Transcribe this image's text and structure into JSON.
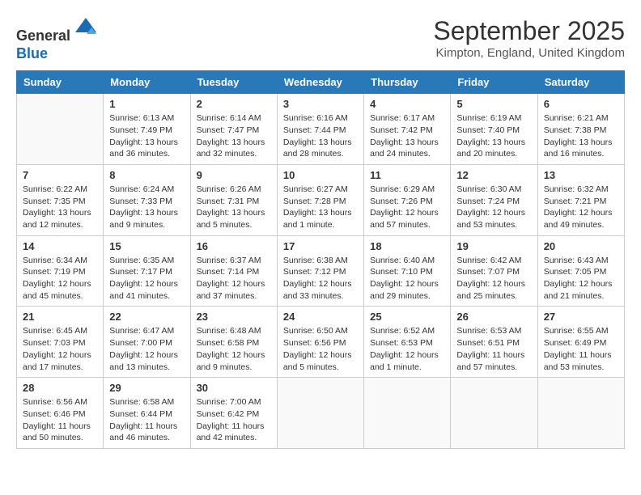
{
  "header": {
    "logo_line1": "General",
    "logo_line2": "Blue",
    "month_title": "September 2025",
    "location": "Kimpton, England, United Kingdom"
  },
  "days_of_week": [
    "Sunday",
    "Monday",
    "Tuesday",
    "Wednesday",
    "Thursday",
    "Friday",
    "Saturday"
  ],
  "weeks": [
    [
      {
        "day": "",
        "info": ""
      },
      {
        "day": "1",
        "info": "Sunrise: 6:13 AM\nSunset: 7:49 PM\nDaylight: 13 hours\nand 36 minutes."
      },
      {
        "day": "2",
        "info": "Sunrise: 6:14 AM\nSunset: 7:47 PM\nDaylight: 13 hours\nand 32 minutes."
      },
      {
        "day": "3",
        "info": "Sunrise: 6:16 AM\nSunset: 7:44 PM\nDaylight: 13 hours\nand 28 minutes."
      },
      {
        "day": "4",
        "info": "Sunrise: 6:17 AM\nSunset: 7:42 PM\nDaylight: 13 hours\nand 24 minutes."
      },
      {
        "day": "5",
        "info": "Sunrise: 6:19 AM\nSunset: 7:40 PM\nDaylight: 13 hours\nand 20 minutes."
      },
      {
        "day": "6",
        "info": "Sunrise: 6:21 AM\nSunset: 7:38 PM\nDaylight: 13 hours\nand 16 minutes."
      }
    ],
    [
      {
        "day": "7",
        "info": "Sunrise: 6:22 AM\nSunset: 7:35 PM\nDaylight: 13 hours\nand 12 minutes."
      },
      {
        "day": "8",
        "info": "Sunrise: 6:24 AM\nSunset: 7:33 PM\nDaylight: 13 hours\nand 9 minutes."
      },
      {
        "day": "9",
        "info": "Sunrise: 6:26 AM\nSunset: 7:31 PM\nDaylight: 13 hours\nand 5 minutes."
      },
      {
        "day": "10",
        "info": "Sunrise: 6:27 AM\nSunset: 7:28 PM\nDaylight: 13 hours\nand 1 minute."
      },
      {
        "day": "11",
        "info": "Sunrise: 6:29 AM\nSunset: 7:26 PM\nDaylight: 12 hours\nand 57 minutes."
      },
      {
        "day": "12",
        "info": "Sunrise: 6:30 AM\nSunset: 7:24 PM\nDaylight: 12 hours\nand 53 minutes."
      },
      {
        "day": "13",
        "info": "Sunrise: 6:32 AM\nSunset: 7:21 PM\nDaylight: 12 hours\nand 49 minutes."
      }
    ],
    [
      {
        "day": "14",
        "info": "Sunrise: 6:34 AM\nSunset: 7:19 PM\nDaylight: 12 hours\nand 45 minutes."
      },
      {
        "day": "15",
        "info": "Sunrise: 6:35 AM\nSunset: 7:17 PM\nDaylight: 12 hours\nand 41 minutes."
      },
      {
        "day": "16",
        "info": "Sunrise: 6:37 AM\nSunset: 7:14 PM\nDaylight: 12 hours\nand 37 minutes."
      },
      {
        "day": "17",
        "info": "Sunrise: 6:38 AM\nSunset: 7:12 PM\nDaylight: 12 hours\nand 33 minutes."
      },
      {
        "day": "18",
        "info": "Sunrise: 6:40 AM\nSunset: 7:10 PM\nDaylight: 12 hours\nand 29 minutes."
      },
      {
        "day": "19",
        "info": "Sunrise: 6:42 AM\nSunset: 7:07 PM\nDaylight: 12 hours\nand 25 minutes."
      },
      {
        "day": "20",
        "info": "Sunrise: 6:43 AM\nSunset: 7:05 PM\nDaylight: 12 hours\nand 21 minutes."
      }
    ],
    [
      {
        "day": "21",
        "info": "Sunrise: 6:45 AM\nSunset: 7:03 PM\nDaylight: 12 hours\nand 17 minutes."
      },
      {
        "day": "22",
        "info": "Sunrise: 6:47 AM\nSunset: 7:00 PM\nDaylight: 12 hours\nand 13 minutes."
      },
      {
        "day": "23",
        "info": "Sunrise: 6:48 AM\nSunset: 6:58 PM\nDaylight: 12 hours\nand 9 minutes."
      },
      {
        "day": "24",
        "info": "Sunrise: 6:50 AM\nSunset: 6:56 PM\nDaylight: 12 hours\nand 5 minutes."
      },
      {
        "day": "25",
        "info": "Sunrise: 6:52 AM\nSunset: 6:53 PM\nDaylight: 12 hours\nand 1 minute."
      },
      {
        "day": "26",
        "info": "Sunrise: 6:53 AM\nSunset: 6:51 PM\nDaylight: 11 hours\nand 57 minutes."
      },
      {
        "day": "27",
        "info": "Sunrise: 6:55 AM\nSunset: 6:49 PM\nDaylight: 11 hours\nand 53 minutes."
      }
    ],
    [
      {
        "day": "28",
        "info": "Sunrise: 6:56 AM\nSunset: 6:46 PM\nDaylight: 11 hours\nand 50 minutes."
      },
      {
        "day": "29",
        "info": "Sunrise: 6:58 AM\nSunset: 6:44 PM\nDaylight: 11 hours\nand 46 minutes."
      },
      {
        "day": "30",
        "info": "Sunrise: 7:00 AM\nSunset: 6:42 PM\nDaylight: 11 hours\nand 42 minutes."
      },
      {
        "day": "",
        "info": ""
      },
      {
        "day": "",
        "info": ""
      },
      {
        "day": "",
        "info": ""
      },
      {
        "day": "",
        "info": ""
      }
    ]
  ]
}
